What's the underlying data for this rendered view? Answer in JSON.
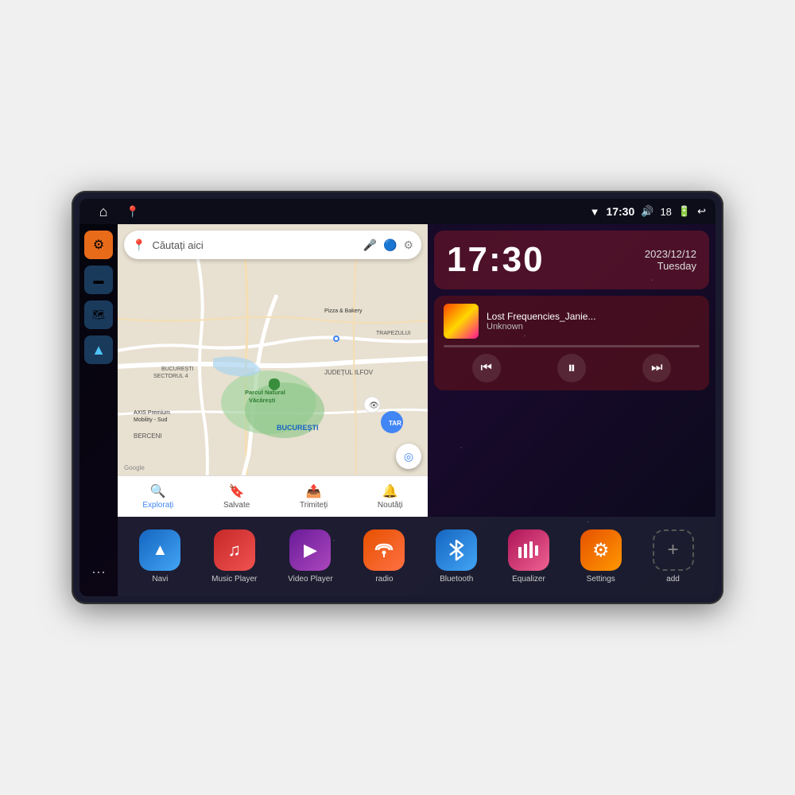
{
  "device": {
    "statusBar": {
      "leftIcons": [
        "home",
        "map-pin"
      ],
      "time": "17:30",
      "rightIcons": [
        "wifi",
        "volume",
        "18",
        "battery",
        "back"
      ]
    },
    "clock": {
      "time": "17:30",
      "date": "2023/12/12",
      "day": "Tuesday"
    },
    "music": {
      "title": "Lost Frequencies_Janie...",
      "artist": "Unknown",
      "albumArt": "gradient"
    },
    "musicControls": {
      "prev": "⏮",
      "pause": "⏸",
      "next": "⏭"
    },
    "map": {
      "searchPlaceholder": "Căutați aici",
      "locations": [
        "AXIS Premium Mobility - Sud",
        "Pizza & Bakery",
        "Parcul Natural Văcărești",
        "BUCUREȘTI",
        "JUDEȚUL ILFOV",
        "BERCENI",
        "BUCUREȘTI SECTORUL 4",
        "TRAPEZULUI"
      ],
      "bottomNav": [
        {
          "label": "Explorați",
          "icon": "🔍",
          "active": true
        },
        {
          "label": "Salvate",
          "icon": "🔖"
        },
        {
          "label": "Trimiteți",
          "icon": "📤"
        },
        {
          "label": "Noutăți",
          "icon": "🔔"
        }
      ]
    },
    "sidebar": [
      {
        "label": "settings",
        "icon": "⚙",
        "type": "orange"
      },
      {
        "label": "tray",
        "icon": "▬",
        "type": "dark-blue"
      },
      {
        "label": "map",
        "icon": "📍",
        "type": "dark-blue"
      },
      {
        "label": "navigation",
        "icon": "▲",
        "type": "nav-arrow"
      },
      {
        "label": "apps",
        "icon": "⋯",
        "type": "apps"
      }
    ],
    "apps": [
      {
        "id": "navi",
        "label": "Navi",
        "icon": "▲",
        "class": "app-navi"
      },
      {
        "id": "music-player",
        "label": "Music Player",
        "icon": "♫",
        "class": "app-music"
      },
      {
        "id": "video-player",
        "label": "Video Player",
        "icon": "▶",
        "class": "app-video"
      },
      {
        "id": "radio",
        "label": "radio",
        "icon": "📻",
        "class": "app-radio"
      },
      {
        "id": "bluetooth",
        "label": "Bluetooth",
        "icon": "⚡",
        "class": "app-bluetooth"
      },
      {
        "id": "equalizer",
        "label": "Equalizer",
        "icon": "🎛",
        "class": "app-equalizer"
      },
      {
        "id": "settings",
        "label": "Settings",
        "icon": "⚙",
        "class": "app-settings"
      },
      {
        "id": "add",
        "label": "add",
        "icon": "+",
        "class": "app-add"
      }
    ]
  }
}
